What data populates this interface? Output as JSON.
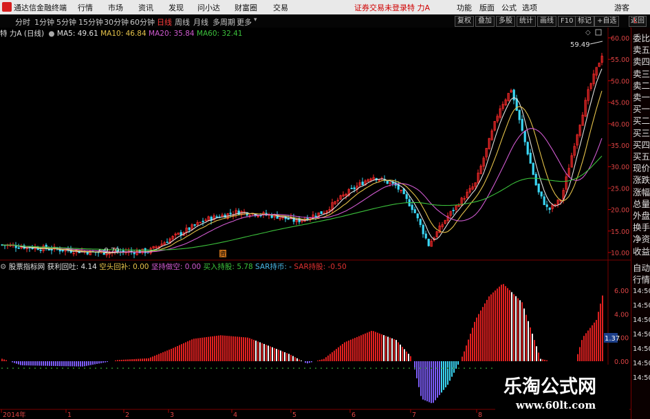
{
  "app": {
    "title": "通达信金融终端",
    "menu": [
      "行情",
      "市场",
      "资讯",
      "发现",
      "问小达",
      "财富圈",
      "交易"
    ],
    "warning": "证券交易未登录",
    "stock_name": "特 力A",
    "right_menu": [
      "功能",
      "版面",
      "公式",
      "选项"
    ],
    "window_menu": "游客"
  },
  "periods": {
    "items": [
      "分时",
      "1分钟",
      "5分钟",
      "15分钟",
      "30分钟",
      "60分钟",
      "日线",
      "周线",
      "月线",
      "多周期",
      "更多"
    ],
    "active": "日线"
  },
  "toolbar_right": [
    "复权",
    "叠加",
    "多股",
    "统计",
    "画线",
    "F10",
    "标记",
    "+自选"
  ],
  "toolbar_corner": [
    "返回"
  ],
  "main_legend": {
    "title": "特 力A (日线)",
    "ma": [
      {
        "label": "MA5: 49.61",
        "color": "#e0e0e0"
      },
      {
        "label": "MA10: 46.84",
        "color": "#e6c34a"
      },
      {
        "label": "MA20: 35.84",
        "color": "#d05ad0"
      },
      {
        "label": "MA60: 32.41",
        "color": "#3cc23c"
      }
    ]
  },
  "sub_legend": {
    "title": "股票指标网",
    "items": [
      {
        "label": "获利回吐: 4.14",
        "color": "#e0e0e0"
      },
      {
        "label": "空头回补: 0.00",
        "color": "#e6c34a"
      },
      {
        "label": "坚持做空: 0.00",
        "color": "#d05ad0"
      },
      {
        "label": "买入持股: 5.78",
        "color": "#3cc23c"
      },
      {
        "label": "SAR持币: -",
        "color": "#4ab8e8"
      },
      {
        "label": "SAR持股: -0.50",
        "color": "#e03030"
      }
    ]
  },
  "price_axis": [
    "60.00",
    "55.00",
    "50.00",
    "45.00",
    "40.00",
    "35.00",
    "30.00",
    "25.00",
    "20.00",
    "15.00",
    "10.00"
  ],
  "sub_axis": [
    "6.00",
    "4.00",
    "2.00",
    "0.00"
  ],
  "sub_axis_badge": "1.37",
  "annotations": {
    "high": "59.49",
    "low": "9.70",
    "event_tag": "资"
  },
  "x_axis": [
    "2014年",
    "1",
    "2",
    "3",
    "4",
    "5",
    "6",
    "7",
    "8"
  ],
  "right_panel": [
    "委比",
    "卖五",
    "卖四",
    "卖三",
    "卖二",
    "卖一",
    "买一",
    "买二",
    "买三",
    "买四",
    "买五",
    "现价",
    "涨跌",
    "涨幅",
    "总量",
    "外盘",
    "换手",
    "净资",
    "收益"
  ],
  "right_panel_lower": [
    "自动",
    "行情",
    "14:50",
    "14:50",
    "14:50",
    "14:50",
    "14:50",
    "14:50",
    "14:50"
  ],
  "watermark": {
    "title": "乐淘公式网",
    "url": "www.60lt.com"
  },
  "colors": {
    "up": "#ff2a2a",
    "down": "#3bd7f5",
    "bg": "#000000",
    "grid": "#5a0000"
  }
}
